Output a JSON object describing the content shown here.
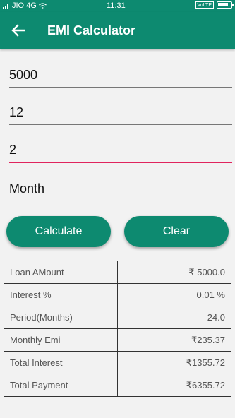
{
  "status_bar": {
    "carrier": "JIO 4G",
    "time": "11:31",
    "volte": "VoLTE"
  },
  "app_bar": {
    "title": "EMI Calculator"
  },
  "inputs": [
    {
      "value": "5000"
    },
    {
      "value": "12"
    },
    {
      "value": "2"
    },
    {
      "value": "Month"
    }
  ],
  "buttons": {
    "calculate": "Calculate",
    "clear": "Clear"
  },
  "results": [
    {
      "label": "Loan AMount",
      "value": "₹ 5000.0"
    },
    {
      "label": "Interest %",
      "value": "0.01 %"
    },
    {
      "label": "Period(Months)",
      "value": "24.0"
    },
    {
      "label": "Monthly Emi",
      "value": "₹235.37"
    },
    {
      "label": "Total Interest",
      "value": "₹1355.72"
    },
    {
      "label": "Total Payment",
      "value": "₹6355.72"
    }
  ],
  "colors": {
    "primary": "#0d8a70",
    "focus_underline": "#e0245e"
  }
}
